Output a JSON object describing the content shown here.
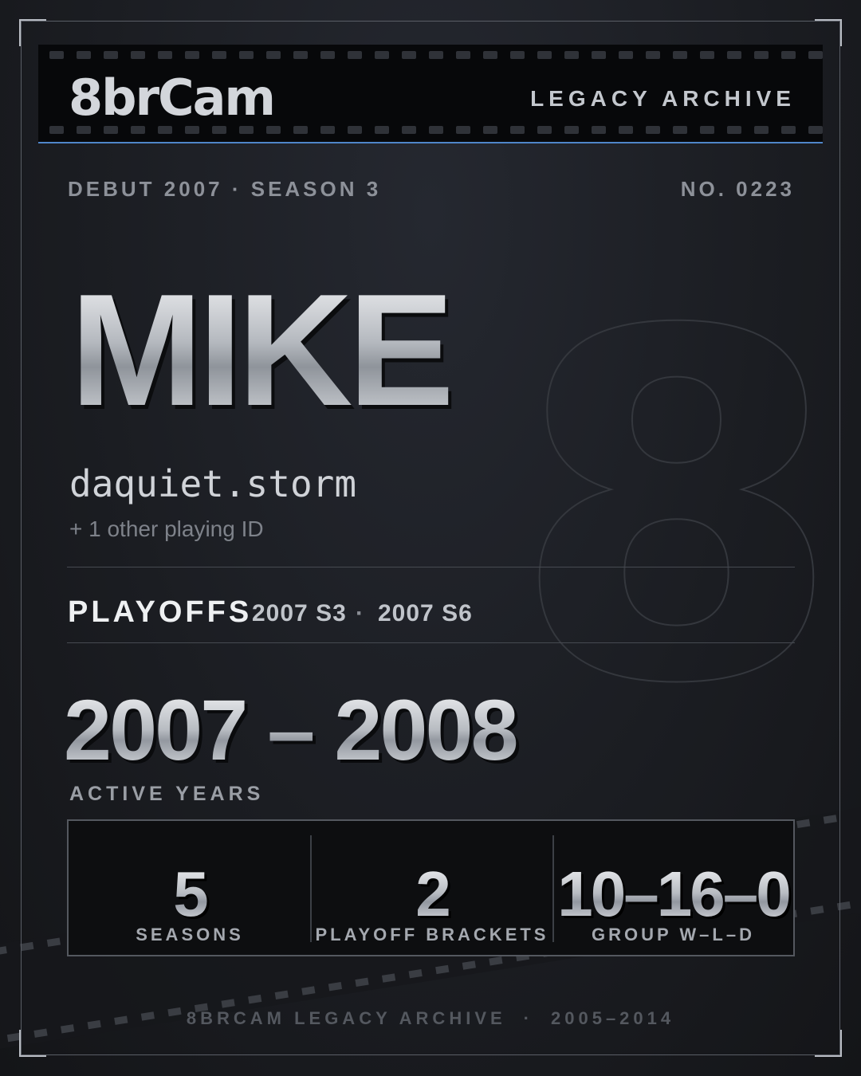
{
  "header": {
    "logo": "8brCam",
    "tag": "LEGACY ARCHIVE",
    "accent_color": "#4f86c9"
  },
  "meta": {
    "debut": "DEBUT 2007 · SEASON 3",
    "number": "NO. 0223"
  },
  "player": {
    "name": "MIKE",
    "handle": "daquiet.storm",
    "other_ids": "+ 1 other playing ID",
    "big_numeral": "8"
  },
  "playoffs": {
    "label": "PLAYOFFS",
    "entries": [
      "2007 S3",
      "2007 S6"
    ],
    "separator": "·"
  },
  "active": {
    "years": "2007 – 2008",
    "label": "ACTIVE YEARS"
  },
  "stats": [
    {
      "value": "5",
      "label": "SEASONS"
    },
    {
      "value": "2",
      "label": "PLAYOFF BRACKETS"
    },
    {
      "value": "10–16–0",
      "label": "GROUP W–L–D"
    }
  ],
  "footer": {
    "left": "8BRCAM LEGACY ARCHIVE",
    "separator": "·",
    "right": "2005–2014"
  }
}
